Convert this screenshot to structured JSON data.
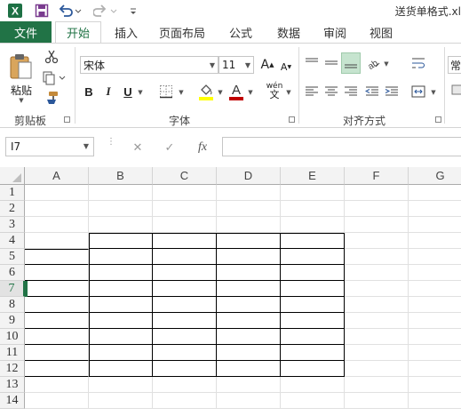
{
  "window": {
    "title": "送货单格式.xl",
    "app_icon": "excel-icon",
    "quick_access": [
      "save-icon",
      "undo-icon",
      "redo-icon",
      "customize-icon"
    ]
  },
  "tabs": {
    "file": "文件",
    "items": [
      "开始",
      "插入",
      "页面布局",
      "公式",
      "数据",
      "审阅",
      "视图"
    ],
    "active": "开始"
  },
  "ribbon": {
    "clipboard": {
      "label": "剪贴板",
      "paste_label": "粘贴"
    },
    "font": {
      "label": "字体",
      "font_name": "宋体",
      "font_size": "11",
      "bold": "B",
      "italic": "I",
      "underline": "U",
      "increase_size": "A",
      "decrease_size": "A",
      "phonetic": "wén",
      "fill_color": "#ffff00",
      "font_color": "#c00000"
    },
    "alignment": {
      "label": "对齐方式"
    },
    "wrap_partial": "常"
  },
  "formula_bar": {
    "name_box": "I7",
    "cancel": "✕",
    "enter": "✓",
    "fx": "fx",
    "content": ""
  },
  "sheet": {
    "columns": [
      "A",
      "B",
      "C",
      "D",
      "E",
      "F",
      "G"
    ],
    "rows": [
      "1",
      "2",
      "3",
      "4",
      "5",
      "6",
      "7",
      "8",
      "9",
      "10",
      "11",
      "12",
      "13",
      "14"
    ],
    "active_row": "7",
    "accent": "#217346"
  }
}
